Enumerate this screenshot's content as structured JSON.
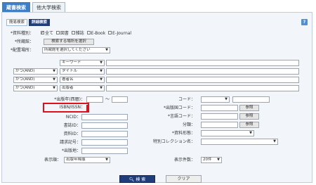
{
  "tabs": [
    "蔵書検索",
    "他大学検索"
  ],
  "subtabs": [
    "簡易検索",
    "詳細検索"
  ],
  "help_label": "?",
  "material_type": {
    "label": "*資料種別：",
    "options": [
      "全て",
      "図書",
      "雑誌",
      "E-Book",
      "E-Journal"
    ]
  },
  "location": {
    "label": "*所蔵館：",
    "button": "検索する場所を選択"
  },
  "shelf": {
    "label": "*配置場所：",
    "selected": "所蔵館を選択してください"
  },
  "keyword_header": "キーワード",
  "rows": [
    {
      "op": "",
      "field": ""
    },
    {
      "op": "かつ(AND)",
      "field": "タイトル"
    },
    {
      "op": "かつ(AND)",
      "field": "著者名"
    },
    {
      "op": "かつ(AND)",
      "field": "出版者"
    }
  ],
  "year": {
    "label": "*出版年(西暦)：",
    "sep": "〜"
  },
  "left_fields": [
    "ISBN/ISSN：",
    "NCID：",
    "書誌ID：",
    "資料ID：",
    "請求記号：",
    "*出版地："
  ],
  "sort": {
    "label": "表示順：",
    "selected": "出版年降順"
  },
  "right_fields": {
    "code": "コード：",
    "country": "*出版国コード：",
    "lang": "*言語コード：",
    "class": "分類：",
    "form": "*資料形態：",
    "collection": "特別コレクション名："
  },
  "ref_button": "参照",
  "count": {
    "label": "表示件数：",
    "selected": "20件"
  },
  "buttons": {
    "search": "検 索",
    "clear": "クリア"
  }
}
